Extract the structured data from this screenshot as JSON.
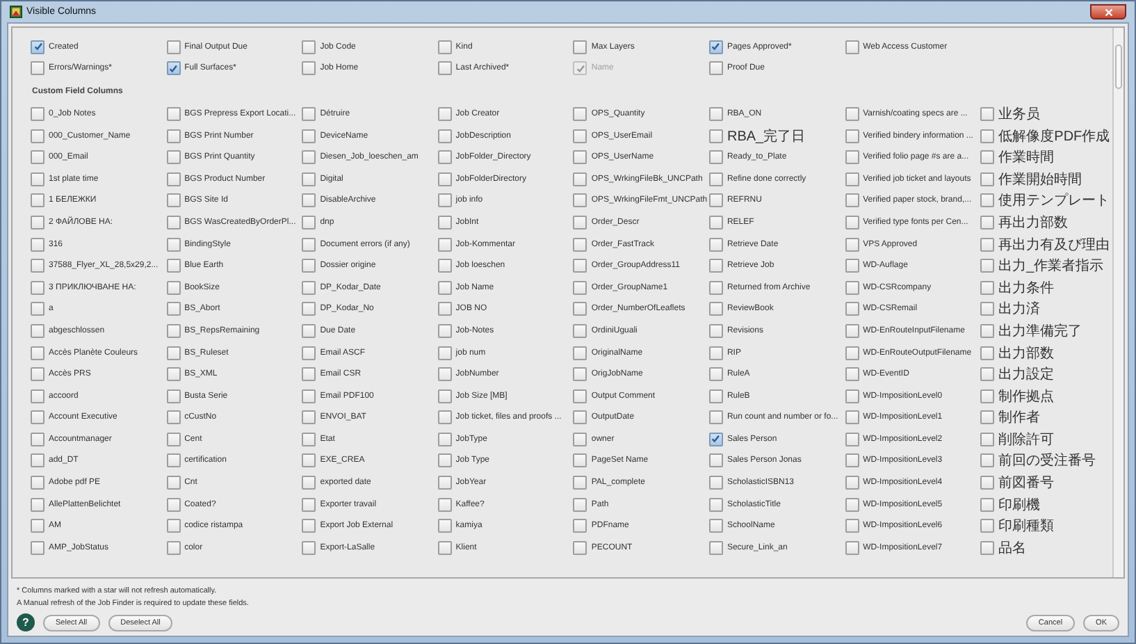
{
  "window": {
    "title": "Visible Columns"
  },
  "standard_columns": [
    {
      "label": "Created",
      "checked": true,
      "disabled": false
    },
    {
      "label": "Final Output Due",
      "checked": false,
      "disabled": false
    },
    {
      "label": "Job Code",
      "checked": false,
      "disabled": false
    },
    {
      "label": "Kind",
      "checked": false,
      "disabled": false
    },
    {
      "label": "Max Layers",
      "checked": false,
      "disabled": false
    },
    {
      "label": "Pages Approved*",
      "checked": true,
      "disabled": false
    },
    {
      "label": "Web Access Customer",
      "checked": false,
      "disabled": false
    }
  ],
  "standard_columns_row_2": [
    {
      "label": "Errors/Warnings*",
      "checked": false,
      "disabled": false
    },
    {
      "label": "Full Surfaces*",
      "checked": true,
      "disabled": false
    },
    {
      "label": "Job Home",
      "checked": false,
      "disabled": false
    },
    {
      "label": "Last Archived*",
      "checked": false,
      "disabled": false
    },
    {
      "label": "Name",
      "checked": true,
      "disabled": true
    },
    {
      "label": "Proof Due",
      "checked": false,
      "disabled": false
    }
  ],
  "custom_heading": "Custom Field Columns",
  "custom_fields": [
    {
      "label": "0_Job Notes",
      "checked": false
    },
    {
      "label": "BGS Prepress Export Locati...",
      "checked": false
    },
    {
      "label": "Détruire",
      "checked": false
    },
    {
      "label": "Job Creator",
      "checked": false
    },
    {
      "label": "OPS_Quantity",
      "checked": false
    },
    {
      "label": "RBA_ON",
      "checked": false
    },
    {
      "label": "Varnish/coating specs are ...",
      "checked": false
    },
    {
      "label": "业务员",
      "checked": false
    },
    {
      "label": "000_Customer_Name",
      "checked": false
    },
    {
      "label": "BGS Print Number",
      "checked": false
    },
    {
      "label": "DeviceName",
      "checked": false
    },
    {
      "label": "JobDescription",
      "checked": false
    },
    {
      "label": "OPS_UserEmail",
      "checked": false
    },
    {
      "label": "RBA_完了日",
      "checked": false
    },
    {
      "label": "Verified bindery information ...",
      "checked": false
    },
    {
      "label": "低解像度PDF作成",
      "checked": false
    },
    {
      "label": "000_Email",
      "checked": false
    },
    {
      "label": "BGS Print Quantity",
      "checked": false
    },
    {
      "label": "Diesen_Job_loeschen_am",
      "checked": false
    },
    {
      "label": "JobFolder_Directory",
      "checked": false
    },
    {
      "label": "OPS_UserName",
      "checked": false
    },
    {
      "label": "Ready_to_Plate",
      "checked": false
    },
    {
      "label": "Verified folio page #s are a...",
      "checked": false
    },
    {
      "label": "作業時間",
      "checked": false
    },
    {
      "label": "1st plate time",
      "checked": false
    },
    {
      "label": "BGS Product Number",
      "checked": false
    },
    {
      "label": "Digital",
      "checked": false
    },
    {
      "label": "JobFolderDirectory",
      "checked": false
    },
    {
      "label": "OPS_WrkingFileBk_UNCPath",
      "checked": false
    },
    {
      "label": "Refine done correctly",
      "checked": false
    },
    {
      "label": "Verified job ticket and layouts",
      "checked": false
    },
    {
      "label": "作業開始時間",
      "checked": false
    },
    {
      "label": "1 БЕЛЕЖКИ",
      "checked": false
    },
    {
      "label": "BGS Site Id",
      "checked": false
    },
    {
      "label": "DisableArchive",
      "checked": false
    },
    {
      "label": "job info",
      "checked": false
    },
    {
      "label": "OPS_WrkingFileFmt_UNCPath",
      "checked": false
    },
    {
      "label": "REFRNU",
      "checked": false
    },
    {
      "label": "Verified paper stock, brand,...",
      "checked": false
    },
    {
      "label": "使用テンプレート",
      "checked": false
    },
    {
      "label": "2 ФАЙЛОВЕ НА:",
      "checked": false
    },
    {
      "label": "BGS WasCreatedByOrderPl...",
      "checked": false
    },
    {
      "label": "dnp",
      "checked": false
    },
    {
      "label": "JobInt",
      "checked": false
    },
    {
      "label": "Order_Descr",
      "checked": false
    },
    {
      "label": "RELEF",
      "checked": false
    },
    {
      "label": "Verified type fonts per Cen...",
      "checked": false
    },
    {
      "label": "再出力部数",
      "checked": false
    },
    {
      "label": "316",
      "checked": false
    },
    {
      "label": "BindingStyle",
      "checked": false
    },
    {
      "label": "Document errors (if any)",
      "checked": false
    },
    {
      "label": "Job-Kommentar",
      "checked": false
    },
    {
      "label": "Order_FastTrack",
      "checked": false
    },
    {
      "label": "Retrieve Date",
      "checked": false
    },
    {
      "label": "VPS Approved",
      "checked": false
    },
    {
      "label": "再出力有及び理由",
      "checked": false
    },
    {
      "label": "37588_Flyer_XL_28,5x29,2...",
      "checked": false
    },
    {
      "label": "Blue Earth",
      "checked": false
    },
    {
      "label": "Dossier origine",
      "checked": false
    },
    {
      "label": "Job loeschen",
      "checked": false
    },
    {
      "label": "Order_GroupAddress11",
      "checked": false
    },
    {
      "label": "Retrieve Job",
      "checked": false
    },
    {
      "label": "WD-Auflage",
      "checked": false
    },
    {
      "label": "出力_作業者指示",
      "checked": false
    },
    {
      "label": "3 ПРИКЛЮЧВАНЕ НА:",
      "checked": false
    },
    {
      "label": "BookSize",
      "checked": false
    },
    {
      "label": "DP_Kodar_Date",
      "checked": false
    },
    {
      "label": "Job Name",
      "checked": false
    },
    {
      "label": "Order_GroupName1",
      "checked": false
    },
    {
      "label": "Returned from Archive",
      "checked": false
    },
    {
      "label": "WD-CSRcompany",
      "checked": false
    },
    {
      "label": "出力条件",
      "checked": false
    },
    {
      "label": "a",
      "checked": false
    },
    {
      "label": "BS_Abort",
      "checked": false
    },
    {
      "label": "DP_Kodar_No",
      "checked": false
    },
    {
      "label": "JOB NO",
      "checked": false
    },
    {
      "label": "Order_NumberOfLeaflets",
      "checked": false
    },
    {
      "label": "ReviewBook",
      "checked": false
    },
    {
      "label": "WD-CSRemail",
      "checked": false
    },
    {
      "label": "出力済",
      "checked": false
    },
    {
      "label": "abgeschlossen",
      "checked": false
    },
    {
      "label": "BS_RepsRemaining",
      "checked": false
    },
    {
      "label": "Due Date",
      "checked": false
    },
    {
      "label": "Job-Notes",
      "checked": false
    },
    {
      "label": "OrdiniUguali",
      "checked": false
    },
    {
      "label": "Revisions",
      "checked": false
    },
    {
      "label": "WD-EnRouteInputFilename",
      "checked": false
    },
    {
      "label": "出力準備完了",
      "checked": false
    },
    {
      "label": "Accès Planète Couleurs",
      "checked": false
    },
    {
      "label": "BS_Ruleset",
      "checked": false
    },
    {
      "label": "Email ASCF",
      "checked": false
    },
    {
      "label": "job num",
      "checked": false
    },
    {
      "label": "OriginalName",
      "checked": false
    },
    {
      "label": "RIP",
      "checked": false
    },
    {
      "label": "WD-EnRouteOutputFilename",
      "checked": false
    },
    {
      "label": "出力部数",
      "checked": false
    },
    {
      "label": "Accès PRS",
      "checked": false
    },
    {
      "label": "BS_XML",
      "checked": false
    },
    {
      "label": "Email CSR",
      "checked": false
    },
    {
      "label": "JobNumber",
      "checked": false
    },
    {
      "label": "OrigJobName",
      "checked": false
    },
    {
      "label": "RuleA",
      "checked": false
    },
    {
      "label": "WD-EventID",
      "checked": false
    },
    {
      "label": "出力設定",
      "checked": false
    },
    {
      "label": "accoord",
      "checked": false
    },
    {
      "label": "Busta Serie",
      "checked": false
    },
    {
      "label": "Email PDF100",
      "checked": false
    },
    {
      "label": "Job Size [MB]",
      "checked": false
    },
    {
      "label": "Output Comment",
      "checked": false
    },
    {
      "label": "RuleB",
      "checked": false
    },
    {
      "label": "WD-ImpositionLevel0",
      "checked": false
    },
    {
      "label": "制作拠点",
      "checked": false
    },
    {
      "label": "Account Executive",
      "checked": false
    },
    {
      "label": "cCustNo",
      "checked": false
    },
    {
      "label": "ENVOI_BAT",
      "checked": false
    },
    {
      "label": "Job ticket, files and proofs ...",
      "checked": false
    },
    {
      "label": "OutputDate",
      "checked": false
    },
    {
      "label": "Run count and number or fo...",
      "checked": false
    },
    {
      "label": "WD-ImpositionLevel1",
      "checked": false
    },
    {
      "label": "制作者",
      "checked": false
    },
    {
      "label": "Accountmanager",
      "checked": false
    },
    {
      "label": "Cent",
      "checked": false
    },
    {
      "label": "Etat",
      "checked": false
    },
    {
      "label": "JobType",
      "checked": false
    },
    {
      "label": "owner",
      "checked": false
    },
    {
      "label": "Sales Person",
      "checked": true
    },
    {
      "label": "WD-ImpositionLevel2",
      "checked": false
    },
    {
      "label": "削除許可",
      "checked": false
    },
    {
      "label": "add_DT",
      "checked": false
    },
    {
      "label": "certification",
      "checked": false
    },
    {
      "label": "EXE_CREA",
      "checked": false
    },
    {
      "label": "Job Type",
      "checked": false
    },
    {
      "label": "PageSet Name",
      "checked": false
    },
    {
      "label": "Sales Person Jonas",
      "checked": false
    },
    {
      "label": "WD-ImpositionLevel3",
      "checked": false
    },
    {
      "label": "前回の受注番号",
      "checked": false
    },
    {
      "label": "Adobe pdf PE",
      "checked": false
    },
    {
      "label": "Cnt",
      "checked": false
    },
    {
      "label": "exported date",
      "checked": false
    },
    {
      "label": "JobYear",
      "checked": false
    },
    {
      "label": "PAL_complete",
      "checked": false
    },
    {
      "label": "ScholasticISBN13",
      "checked": false
    },
    {
      "label": "WD-ImpositionLevel4",
      "checked": false
    },
    {
      "label": "前図番号",
      "checked": false
    },
    {
      "label": "AllePlattenBelichtet",
      "checked": false
    },
    {
      "label": "Coated?",
      "checked": false
    },
    {
      "label": "Exporter travail",
      "checked": false
    },
    {
      "label": "Kaffee?",
      "checked": false
    },
    {
      "label": "Path",
      "checked": false
    },
    {
      "label": "ScholasticTitle",
      "checked": false
    },
    {
      "label": "WD-ImpositionLevel5",
      "checked": false
    },
    {
      "label": "印刷機",
      "checked": false
    },
    {
      "label": "AM",
      "checked": false
    },
    {
      "label": "codice ristampa",
      "checked": false
    },
    {
      "label": "Export Job External",
      "checked": false
    },
    {
      "label": "kamiya",
      "checked": false
    },
    {
      "label": "PDFname",
      "checked": false
    },
    {
      "label": "SchoolName",
      "checked": false
    },
    {
      "label": "WD-ImpositionLevel6",
      "checked": false
    },
    {
      "label": "印刷種類",
      "checked": false
    },
    {
      "label": "AMP_JobStatus",
      "checked": false
    },
    {
      "label": "color",
      "checked": false
    },
    {
      "label": "Export-LaSalle",
      "checked": false
    },
    {
      "label": "Klient",
      "checked": false
    },
    {
      "label": "PECOUNT",
      "checked": false
    },
    {
      "label": "Secure_Link_an",
      "checked": false
    },
    {
      "label": "WD-ImpositionLevel7",
      "checked": false
    },
    {
      "label": "品名",
      "checked": false
    }
  ],
  "notes": [
    "* Columns marked with a star will not refresh automatically.",
    "A Manual refresh of the Job Finder is required to update these fields."
  ],
  "help_button": "?",
  "left_buttons": [
    "Select All",
    "Deselect All"
  ],
  "right_buttons": [
    "Cancel",
    "OK"
  ]
}
